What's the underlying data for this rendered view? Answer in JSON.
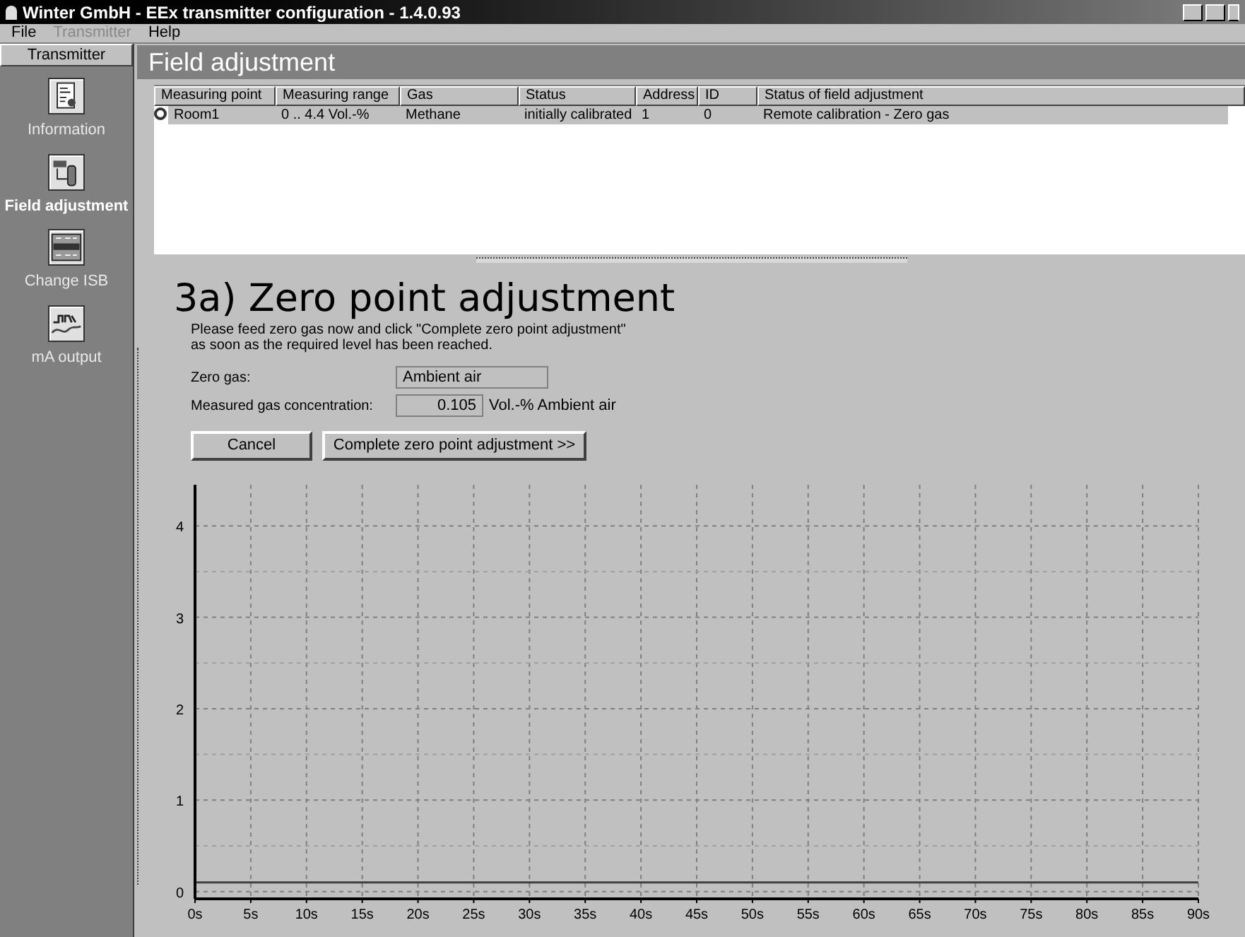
{
  "window": {
    "title": "Winter GmbH - EEx transmitter configuration - 1.4.0.93"
  },
  "menu": [
    {
      "label": "File",
      "disabled": false
    },
    {
      "label": "Transmitter",
      "disabled": true
    },
    {
      "label": "Help",
      "disabled": false
    }
  ],
  "sidebar": {
    "header": "Transmitter",
    "items": [
      {
        "label": "Information",
        "kind": "info",
        "selected": false
      },
      {
        "label": "Field adjustment",
        "kind": "field",
        "selected": true
      },
      {
        "label": "Change ISB",
        "kind": "isb",
        "selected": false
      },
      {
        "label": "mA output",
        "kind": "ma",
        "selected": false
      }
    ]
  },
  "page_title": "Field adjustment",
  "table": {
    "columns": [
      "Measuring point",
      "Measuring range",
      "Gas",
      "Status",
      "Address",
      "ID",
      "Status of field adjustment"
    ],
    "rows": [
      {
        "selected": true,
        "cells": [
          "Room1",
          "0 .. 4.4 Vol.-%",
          "Methane",
          "initially calibrated",
          "1",
          "0",
          "Remote calibration - Zero gas"
        ]
      }
    ]
  },
  "step": {
    "title": "3a) Zero point adjustment",
    "instruction": "Please feed zero gas now and click \"Complete zero point adjustment\" as soon as the required level has been reached.",
    "zero_gas_label": "Zero gas:",
    "zero_gas_value": "Ambient air",
    "concentration_label": "Measured gas concentration:",
    "concentration_value": "0.105",
    "concentration_unit": "Vol.-% Ambient air",
    "buttons": [
      "Cancel",
      "Complete zero point adjustment >>"
    ]
  },
  "chart_data": {
    "type": "line",
    "x": [
      0,
      90
    ],
    "series": [
      {
        "color": "#404040",
        "values": [
          0.1,
          0.1
        ]
      }
    ],
    "grid": true,
    "xlim": [
      0,
      90
    ],
    "ylim": [
      -0.08,
      4.45
    ],
    "xticks": [
      {
        "value": 0,
        "label": "0s"
      },
      {
        "value": 5,
        "label": "5s"
      },
      {
        "value": 10,
        "label": "10s"
      },
      {
        "value": 15,
        "label": "15s"
      },
      {
        "value": 20,
        "label": "20s"
      },
      {
        "value": 25,
        "label": "25s"
      },
      {
        "value": 30,
        "label": "30s"
      },
      {
        "value": 35,
        "label": "35s"
      },
      {
        "value": 40,
        "label": "40s"
      },
      {
        "value": 45,
        "label": "45s"
      },
      {
        "value": 50,
        "label": "50s"
      },
      {
        "value": 55,
        "label": "55s"
      },
      {
        "value": 60,
        "label": "60s"
      },
      {
        "value": 65,
        "label": "65s"
      },
      {
        "value": 70,
        "label": "70s"
      },
      {
        "value": 75,
        "label": "75s"
      },
      {
        "value": 80,
        "label": "80s"
      },
      {
        "value": 85,
        "label": "85s"
      },
      {
        "value": 90,
        "label": "90s"
      }
    ],
    "yticks": [
      0,
      1,
      2,
      3,
      4
    ]
  }
}
